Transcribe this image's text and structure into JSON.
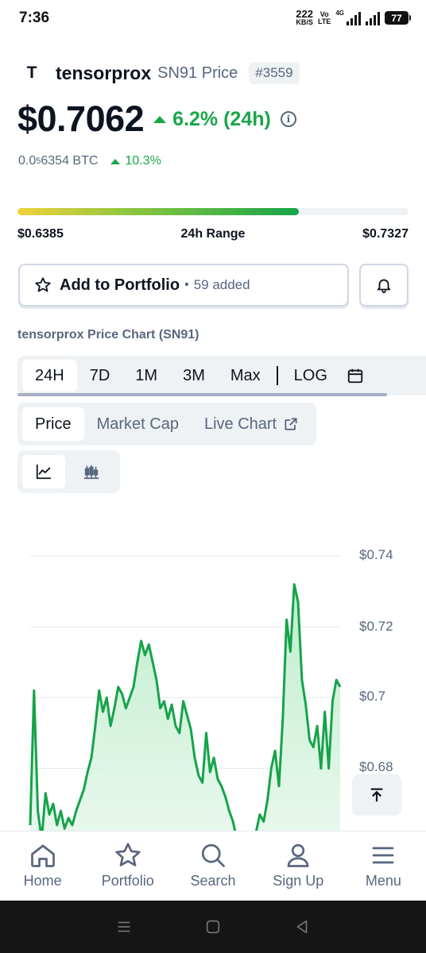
{
  "status_bar": {
    "time": "7:36",
    "net_speed_value": "222",
    "net_speed_unit": "KB/S",
    "volte_top": "Vo",
    "volte_bottom": "LTE",
    "network": "4G",
    "battery": "77"
  },
  "coin": {
    "logo_glyph": "T",
    "name": "tensorprox",
    "symbol": "SN91 Price",
    "rank": "#3559",
    "price": "$0.7062",
    "change_24h": "6.2% (24h)",
    "btc_price_prefix": "0.0",
    "btc_price_sub": "5",
    "btc_price_suffix": "6354 BTC",
    "btc_change": "10.3%"
  },
  "range": {
    "low": "$0.6385",
    "label": "24h Range",
    "high": "$0.7327",
    "current_fraction": 0.719
  },
  "portfolio": {
    "label": "Add to Portfolio",
    "separator": "•",
    "count": "59 added"
  },
  "chart_title": "tensorprox Price Chart (SN91)",
  "time_tabs": [
    "24H",
    "7D",
    "1M",
    "3M",
    "Max"
  ],
  "log_label": "LOG",
  "type_tabs": {
    "price": "Price",
    "market_cap": "Market Cap",
    "live_chart": "Live Chart"
  },
  "colors": {
    "accent_green": "#1aa64a",
    "line_green": "#16a34a",
    "fill_green": "#d6f3de",
    "text_dark": "#0d1421",
    "text_gray": "#58667e",
    "panel_bg": "#eff2f5"
  },
  "chart_data": {
    "type": "area",
    "title": "",
    "xlabel": "",
    "ylabel": "",
    "y_ticks": [
      "$0.74",
      "$0.72",
      "$0.7",
      "$0.68"
    ],
    "ylim": [
      0.6625,
      0.7445
    ],
    "grid": true,
    "series": [
      {
        "values": [
          0.664,
          0.702,
          0.668,
          0.66,
          0.673,
          0.667,
          0.67,
          0.664,
          0.668,
          0.663,
          0.666,
          0.664,
          0.668,
          0.671,
          0.674,
          0.679,
          0.683,
          0.692,
          0.702,
          0.696,
          0.7,
          0.692,
          0.697,
          0.703,
          0.701,
          0.697,
          0.7,
          0.703,
          0.71,
          0.716,
          0.712,
          0.715,
          0.71,
          0.705,
          0.697,
          0.699,
          0.694,
          0.698,
          0.692,
          0.69,
          0.699,
          0.695,
          0.691,
          0.683,
          0.678,
          0.676,
          0.69,
          0.679,
          0.683,
          0.677,
          0.675,
          0.672,
          0.668,
          0.665,
          0.66,
          0.655,
          0.65,
          0.652,
          0.658,
          0.662,
          0.667,
          0.665,
          0.671,
          0.68,
          0.685,
          0.675,
          0.694,
          0.722,
          0.713,
          0.732,
          0.727,
          0.705,
          0.698,
          0.688,
          0.686,
          0.692,
          0.68,
          0.696,
          0.68,
          0.699,
          0.705,
          0.703
        ]
      }
    ]
  },
  "scroll_top_icon": "arrow-up-to-line-icon",
  "bottom_nav": [
    {
      "label": "Home",
      "icon": "home-icon"
    },
    {
      "label": "Portfolio",
      "icon": "star-icon"
    },
    {
      "label": "Search",
      "icon": "search-icon"
    },
    {
      "label": "Sign Up",
      "icon": "user-icon"
    },
    {
      "label": "Menu",
      "icon": "menu-icon"
    }
  ]
}
